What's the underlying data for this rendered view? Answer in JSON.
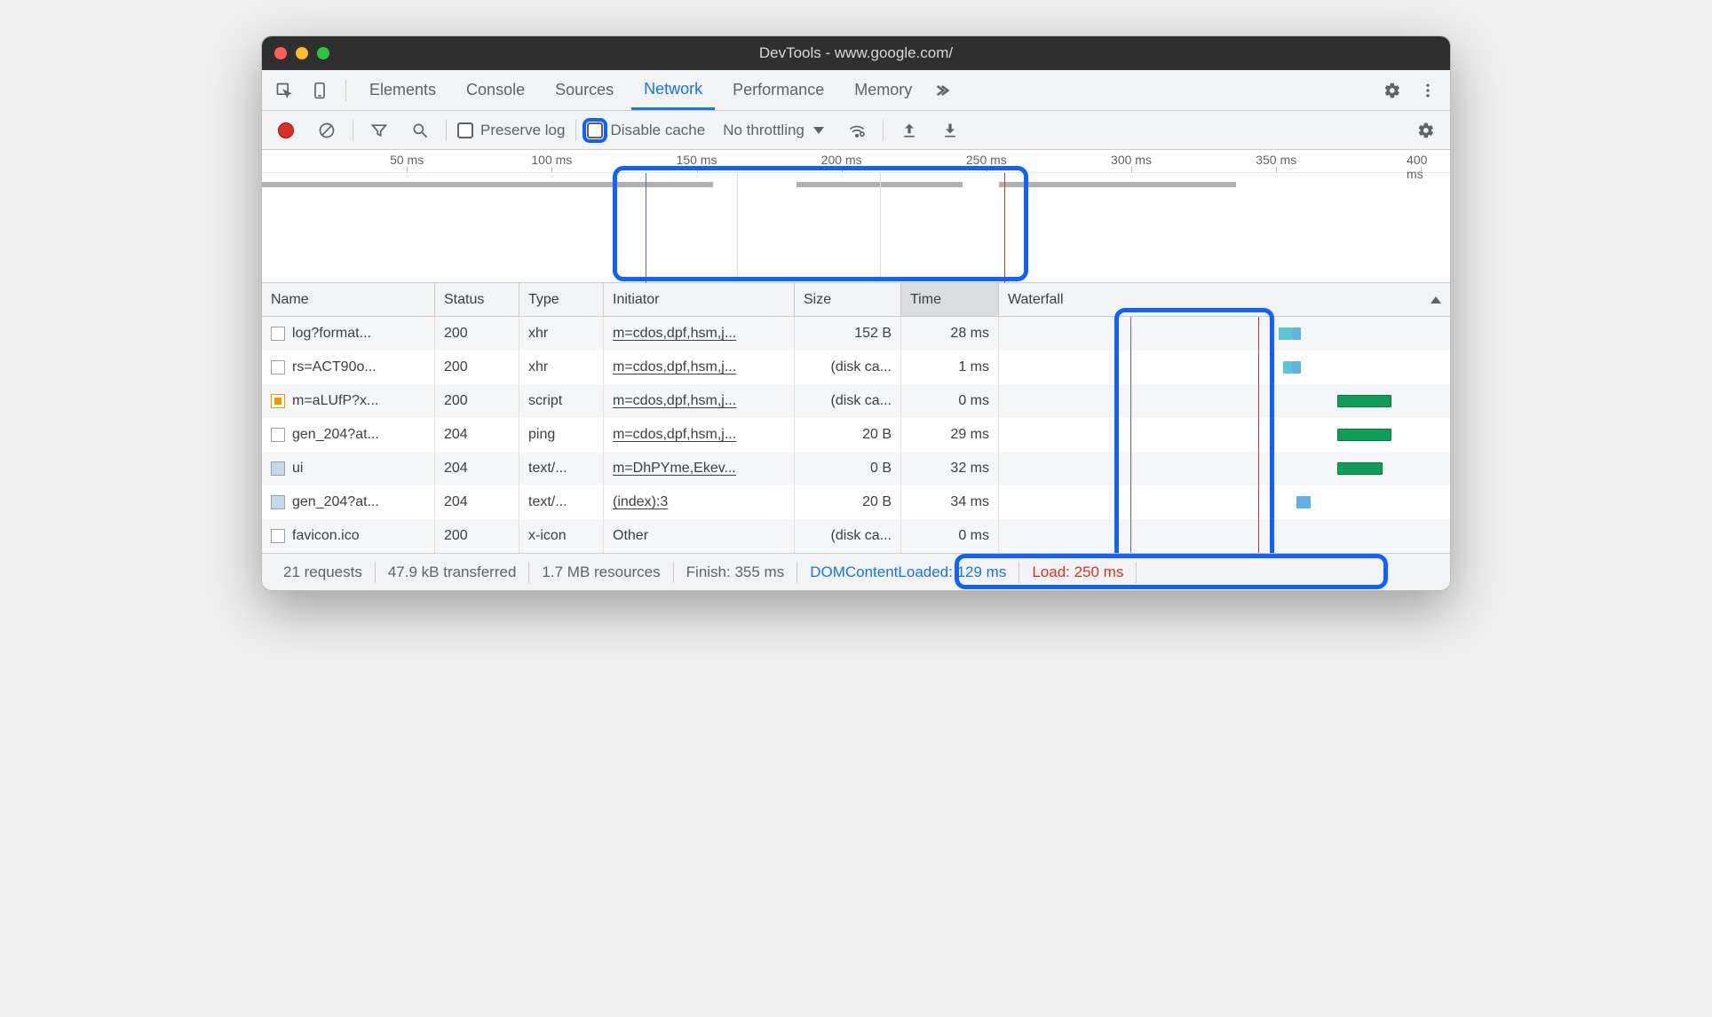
{
  "window": {
    "title": "DevTools - www.google.com/"
  },
  "tabs": [
    "Elements",
    "Console",
    "Sources",
    "Network",
    "Performance",
    "Memory"
  ],
  "activeTab": "Network",
  "toolbar": {
    "preserve_log": "Preserve log",
    "disable_cache": "Disable cache",
    "throttling": "No throttling"
  },
  "timeline": {
    "ticks": [
      "50 ms",
      "100 ms",
      "150 ms",
      "200 ms",
      "250 ms",
      "300 ms",
      "350 ms",
      "400 ms"
    ]
  },
  "columns": {
    "name": "Name",
    "status": "Status",
    "type": "Type",
    "initiator": "Initiator",
    "size": "Size",
    "time": "Time",
    "waterfall": "Waterfall"
  },
  "rows": [
    {
      "name": "log?format...",
      "status": "200",
      "type": "xhr",
      "initiator": "m=cdos,dpf,hsm,j...",
      "size": "152 B",
      "time": "28 ms",
      "icon": "doc",
      "wf": {
        "start": 62,
        "len": 3,
        "cls": "wf-teal",
        "tail": {
          "start": 65,
          "len": 2,
          "cls": "wf-blue"
        }
      }
    },
    {
      "name": "rs=ACT90o...",
      "status": "200",
      "type": "xhr",
      "initiator": "m=cdos,dpf,hsm,j...",
      "size": "(disk ca...",
      "time": "1 ms",
      "icon": "doc",
      "wf": {
        "start": 63,
        "len": 2,
        "cls": "wf-teal",
        "tail": {
          "start": 65,
          "len": 2,
          "cls": "wf-blue"
        }
      }
    },
    {
      "name": "m=aLUfP?x...",
      "status": "200",
      "type": "script",
      "initiator": "m=cdos,dpf,hsm,j...",
      "size": "(disk ca...",
      "time": "0 ms",
      "icon": "js",
      "wf": {
        "start": 75,
        "len": 12,
        "cls": "wf-green"
      }
    },
    {
      "name": "gen_204?at...",
      "status": "204",
      "type": "ping",
      "initiator": "m=cdos,dpf,hsm,j...",
      "size": "20 B",
      "time": "29 ms",
      "icon": "doc",
      "wf": {
        "start": 75,
        "len": 12,
        "cls": "wf-green"
      }
    },
    {
      "name": "ui",
      "status": "204",
      "type": "text/...",
      "initiator": "m=DhPYme,Ekev...",
      "size": "0 B",
      "time": "32 ms",
      "icon": "img",
      "wf": {
        "start": 75,
        "len": 10,
        "cls": "wf-green"
      }
    },
    {
      "name": "gen_204?at...",
      "status": "204",
      "type": "text/...",
      "initiator": "(index):3",
      "size": "20 B",
      "time": "34 ms",
      "icon": "img",
      "wf": {
        "start": 66,
        "len": 3,
        "cls": "wf-blue"
      }
    },
    {
      "name": "favicon.ico",
      "status": "200",
      "type": "x-icon",
      "initiator": "Other",
      "initiator_plain": true,
      "size": "(disk ca...",
      "time": "0 ms",
      "icon": "doc",
      "wf": {}
    }
  ],
  "status": {
    "requests": "21 requests",
    "transferred": "47.9 kB transferred",
    "resources": "1.7 MB resources",
    "finish": "Finish: 355 ms",
    "dcl": "DOMContentLoaded: 129 ms",
    "load": "Load: 250 ms"
  }
}
